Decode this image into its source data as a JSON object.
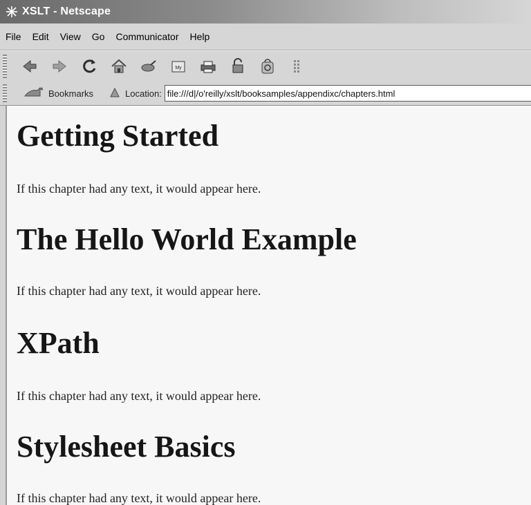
{
  "window": {
    "title": "XSLT - Netscape",
    "app_icon": "netscape-icon"
  },
  "menubar": {
    "items": [
      "File",
      "Edit",
      "View",
      "Go",
      "Communicator",
      "Help"
    ]
  },
  "toolbar": {
    "buttons": [
      "back-icon",
      "forward-icon",
      "reload-icon",
      "home-icon",
      "search-icon",
      "my-netscape-icon",
      "print-icon",
      "security-icon",
      "shop-icon",
      "stop-icon"
    ]
  },
  "locationbar": {
    "bookmarks_label": "Bookmarks",
    "location_label": "Location:",
    "url": "file:///d|/o'reilly/xslt/booksamples/appendixc/chapters.html"
  },
  "content": {
    "chapters": [
      {
        "heading": "Getting Started",
        "text": "If this chapter had any text, it would appear here."
      },
      {
        "heading": "The Hello World Example",
        "text": "If this chapter had any text, it would appear here."
      },
      {
        "heading": "XPath",
        "text": "If this chapter had any text, it would appear here."
      },
      {
        "heading": "Stylesheet Basics",
        "text": "If this chapter had any text, it would appear here."
      }
    ]
  }
}
